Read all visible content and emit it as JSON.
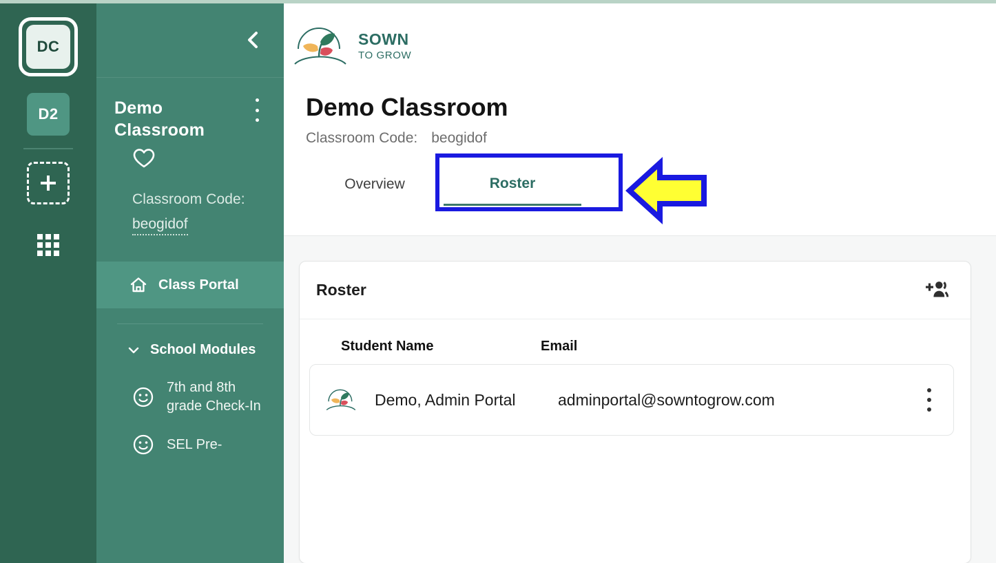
{
  "rail": {
    "active_tile": "DC",
    "second_tile": "D2",
    "add_label": "+",
    "grid_icon": "grid-apps-icon"
  },
  "sidebar": {
    "collapse_icon": "chevron-left-icon",
    "kebab_icon": "kebab-menu-icon",
    "classroom_name": "Demo Classroom",
    "favorite_icon": "heart-icon",
    "code_label": "Classroom Code:",
    "code_value": "beogidof",
    "nav": [
      {
        "label": "Class Portal",
        "icon": "home-icon",
        "active": true
      }
    ],
    "groups": [
      {
        "label": "School Modules",
        "icon": "chevron-down-icon",
        "expanded": true,
        "items": [
          {
            "label": "7th and 8th grade Check-In",
            "icon": "smiley-face-icon"
          },
          {
            "label": "SEL Pre-",
            "icon": "smiley-face-icon"
          }
        ]
      }
    ]
  },
  "header": {
    "logo_line1": "SOWN",
    "logo_line2": "TO GROW",
    "logo_icon": "sown-to-grow-logo"
  },
  "page": {
    "title": "Demo Classroom",
    "code_label": "Classroom Code:",
    "code_value": "beogidof"
  },
  "tabs": [
    {
      "label": "Overview",
      "active": false
    },
    {
      "label": "Roster",
      "active": true
    }
  ],
  "annotation": {
    "highlight_color": "#1a1ae0",
    "arrow_fill": "#ffff33",
    "arrow_stroke": "#1a1ae0",
    "arrow_icon": "arrow-left-annotation"
  },
  "roster": {
    "card_title": "Roster",
    "add_student_icon": "person-add-icon",
    "columns": [
      "Student Name",
      "Email"
    ],
    "rows": [
      {
        "avatar_icon": "sown-to-grow-logo-avatar",
        "name": "Demo, Admin Portal",
        "email": "adminportal@sowntogrow.com",
        "menu_icon": "kebab-menu-icon"
      }
    ]
  },
  "colors": {
    "rail_green": "#2f6552",
    "sidebar_green": "#438472",
    "active_green": "#4f9683",
    "brand_teal": "#2c6d63",
    "page_bg": "#f6f7f7"
  }
}
